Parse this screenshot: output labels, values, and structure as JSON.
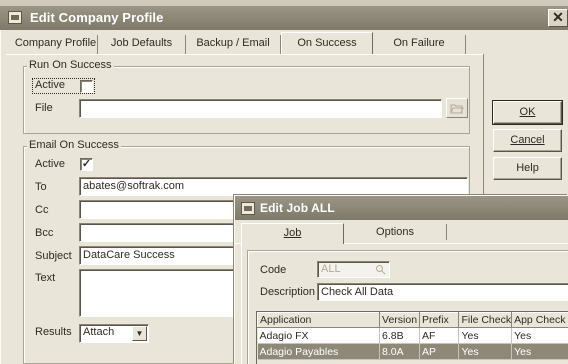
{
  "main_dialog": {
    "title": "Edit Company Profile",
    "close_glyph": "✕",
    "tabs": [
      {
        "label": "Company Profile",
        "active": false
      },
      {
        "label": "Job Defaults",
        "active": false
      },
      {
        "label": "Backup / Email",
        "active": false
      },
      {
        "label": "On Success",
        "active": true
      },
      {
        "label": "On Failure",
        "active": false
      }
    ],
    "run_on_success": {
      "group_label": "Run On Success",
      "active_label": "Active",
      "active_checked": false,
      "file_label": "File",
      "file_value": "",
      "browse_icon": "folder-open-icon"
    },
    "email_on_success": {
      "group_label": "Email On Success",
      "active_label": "Active",
      "active_checked": true,
      "to_label": "To",
      "to_value": "abates@softrak.com",
      "cc_label": "Cc",
      "cc_value": "",
      "bcc_label": "Bcc",
      "bcc_value": "",
      "subject_label": "Subject",
      "subject_value": "DataCare Success",
      "text_label": "Text",
      "text_value": "",
      "results_label": "Results",
      "results_value": "Attach"
    },
    "buttons": {
      "ok": "OK",
      "cancel": "Cancel",
      "help": "Help"
    }
  },
  "job_dialog": {
    "title": "Edit Job ALL",
    "tabs": [
      {
        "label": "Job",
        "active": true
      },
      {
        "label": "Options",
        "active": false
      }
    ],
    "code_label": "Code",
    "code_value": "ALL",
    "description_label": "Description",
    "description_value": "Check All Data",
    "grid": {
      "columns": [
        "Application",
        "Version",
        "Prefix",
        "File Check",
        "App Check"
      ],
      "rows": [
        {
          "application": "Adagio FX",
          "version": "6.8B",
          "prefix": "AF",
          "file_check": "Yes",
          "app_check": "Yes",
          "selected": false
        },
        {
          "application": "Adagio Payables",
          "version": "8.0A",
          "prefix": "AP",
          "file_check": "Yes",
          "app_check": "Yes",
          "selected": true
        }
      ]
    }
  },
  "colors": {
    "title_bar": "#8a8474",
    "dialog_bg": "#e9e5d9",
    "selection": "#8e8878"
  }
}
